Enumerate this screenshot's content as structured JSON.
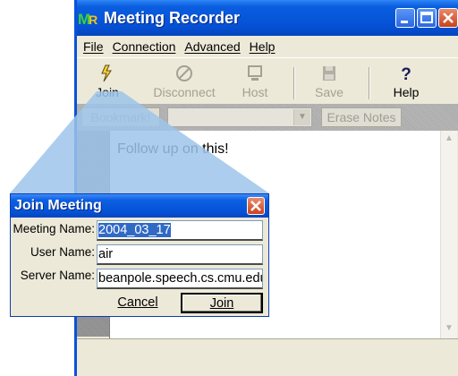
{
  "window": {
    "title": "Meeting Recorder",
    "logo_m": "M",
    "logo_r": "R"
  },
  "menu": [
    "File",
    "Connection",
    "Advanced",
    "Help"
  ],
  "toolbar": {
    "join": "Join",
    "disconnect": "Disconnect",
    "host": "Host",
    "save": "Save",
    "help": "Help"
  },
  "bookmark_bar": {
    "bookmark": "Bookmark!",
    "combo_value": "",
    "erase_notes": "Erase Notes"
  },
  "notes": {
    "text": "Follow up on  this!"
  },
  "dialog": {
    "title": "Join Meeting",
    "meeting_name_label": "Meeting Name:",
    "meeting_name_value": "2004_03_17",
    "user_name_label": "User Name:",
    "user_name_value": "air",
    "server_name_label": "Server Name:",
    "server_name_value": "beanpole.speech.cs.cmu.edu",
    "cancel": "Cancel",
    "join": "Join"
  },
  "colors": {
    "titlebar_blue": "#0552d6",
    "callout_blue": "#9ec4ea",
    "selection": "#316ac5"
  },
  "icons": {
    "join": "lightning-plug-icon",
    "disconnect": "no-plug-icon",
    "host": "computer-icon",
    "save": "floppy-disk-icon",
    "help": "question-mark-icon"
  }
}
